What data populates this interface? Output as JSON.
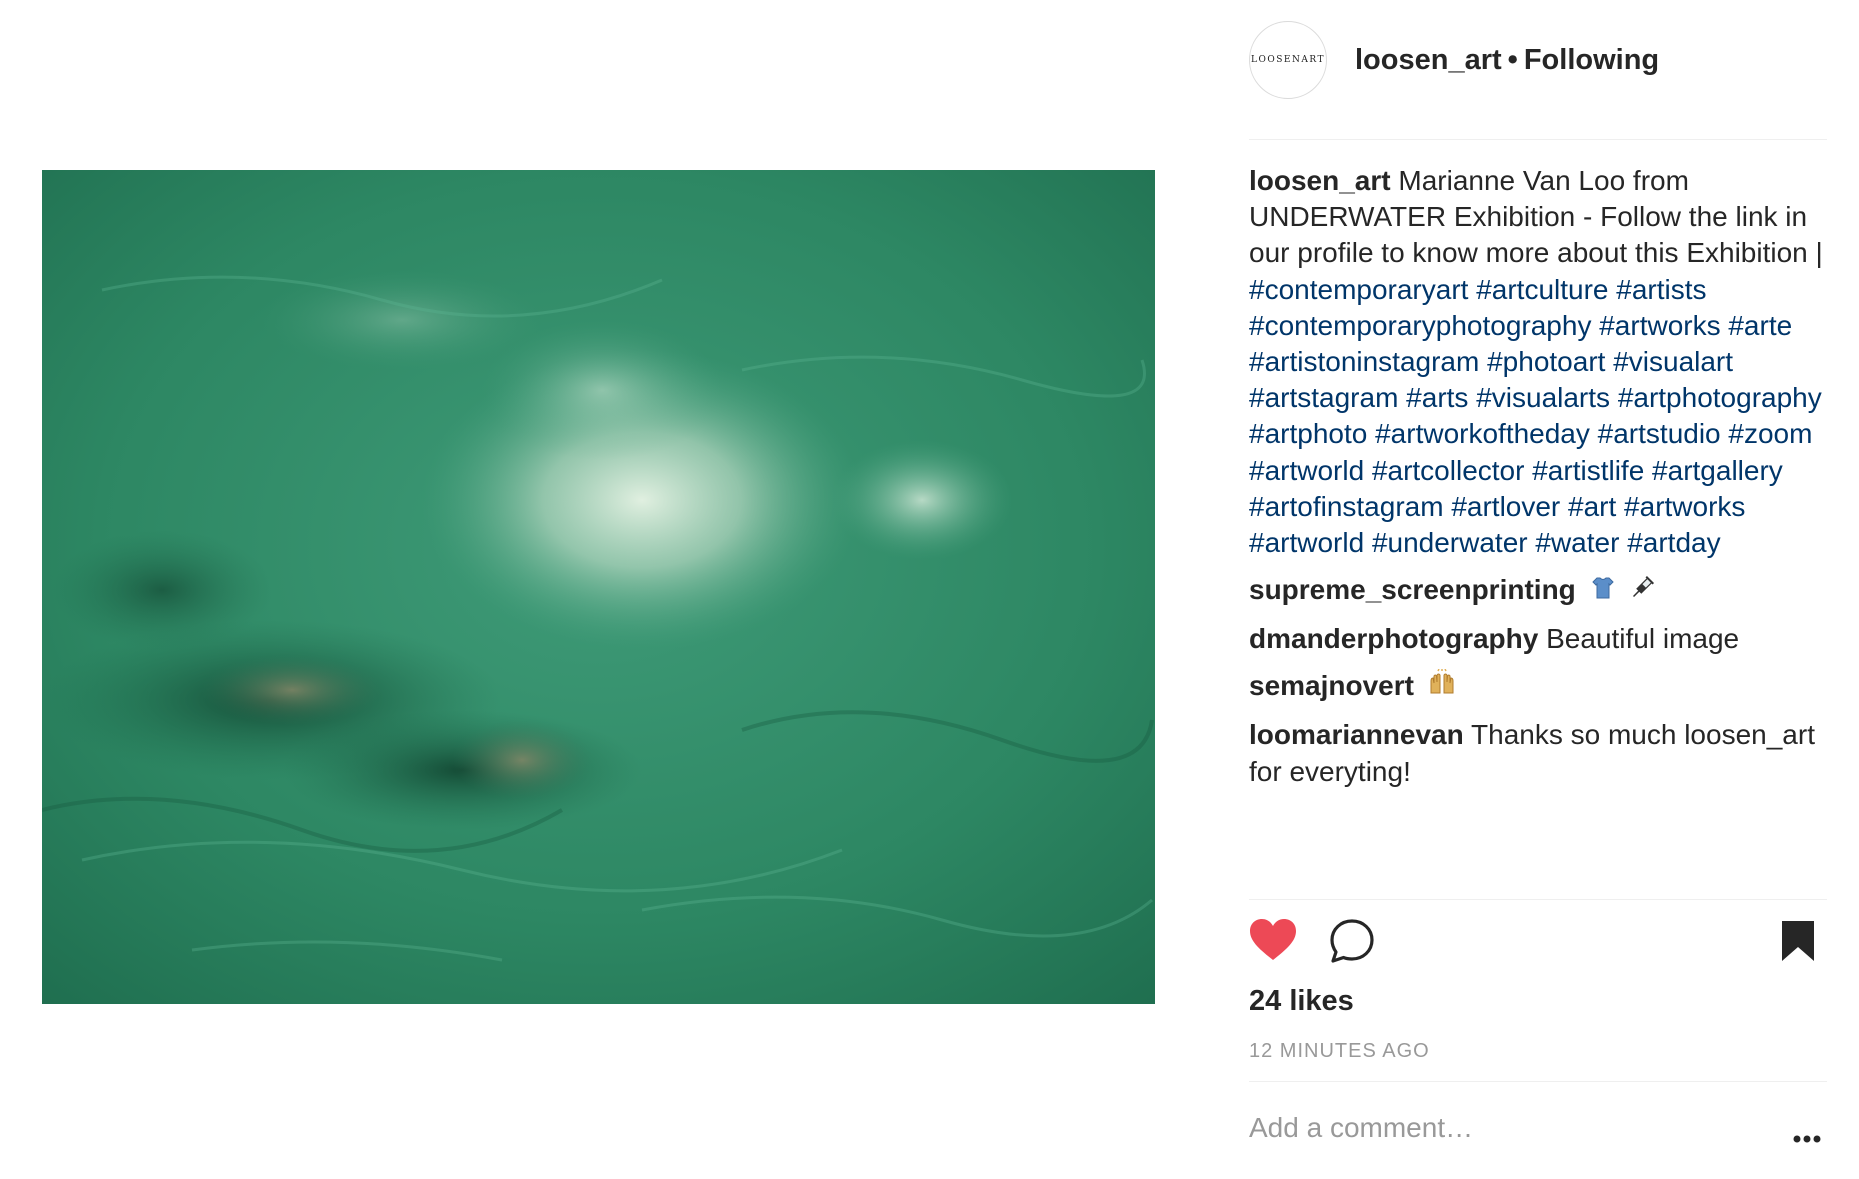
{
  "header": {
    "avatar_text": "LOOSENART",
    "username": "loosen_art",
    "separator": "•",
    "follow_status": "Following"
  },
  "caption": {
    "username": "loosen_art",
    "text": "Marianne Van Loo from UNDERWATER Exhibition - Follow the link in our profile to know more about this Exhibition |",
    "hashtags": "#contemporaryart #artculture #artists #contemporaryphotography #artworks #arte #artistoninstagram #photoart #visualart #artstagram #arts #visualarts #artphotography #artphoto #artworkoftheday #artstudio #zoom #artworld #artcollector #artistlife #artgallery #artofinstagram #artlover #art #artworks #artworld #underwater #water #artday"
  },
  "comments": [
    {
      "username": "supreme_screenprinting",
      "text": "",
      "emoji": [
        "tshirt-icon",
        "syringe-icon"
      ]
    },
    {
      "username": "dmanderphotography",
      "text": "Beautiful image",
      "emoji": []
    },
    {
      "username": "semajnovert",
      "text": "",
      "emoji": [
        "raised-hands-icon"
      ]
    },
    {
      "username": "loomariannevan",
      "text": "Thanks so much loosen_art for everyting!",
      "emoji": []
    }
  ],
  "likes": "24 likes",
  "timestamp": "12 MINUTES AGO",
  "add_comment_placeholder": "Add a comment…",
  "colors": {
    "heart": "#ed4956",
    "hashtag": "#003569",
    "text": "#262626",
    "muted": "#999999",
    "water": "#2e8a66"
  }
}
